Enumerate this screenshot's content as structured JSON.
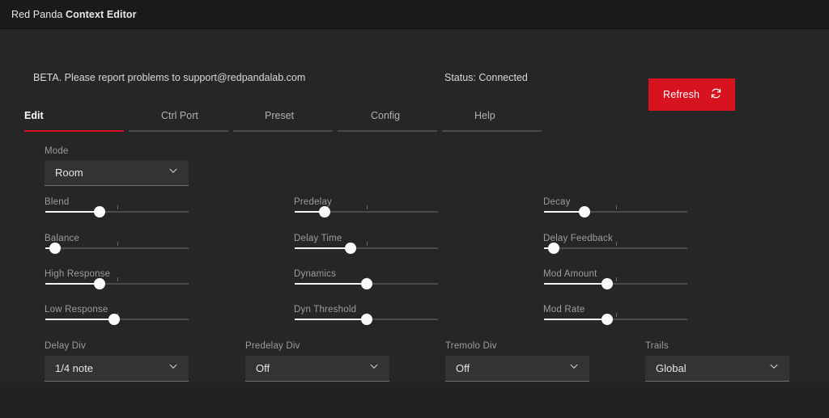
{
  "titlebar": {
    "app_prefix": "Red Panda ",
    "app_title": "Context Editor"
  },
  "header": {
    "beta_notice": "BETA. Please report problems to support@redpandalab.com",
    "status": "Status: Connected",
    "refresh_label": "Refresh",
    "refresh_icon": "refresh-icon",
    "accent_color": "#d7131f"
  },
  "tabs": [
    {
      "label": "Edit",
      "active": true
    },
    {
      "label": "Ctrl Port",
      "active": false
    },
    {
      "label": "Preset",
      "active": false
    },
    {
      "label": "Config",
      "active": false
    },
    {
      "label": "Help",
      "active": false
    }
  ],
  "mode": {
    "label": "Mode",
    "value": "Room"
  },
  "sliders": {
    "column1": [
      {
        "label": "Blend",
        "value": 38
      },
      {
        "label": "Balance",
        "value": 7
      },
      {
        "label": "High Response",
        "value": 38
      },
      {
        "label": "Low Response",
        "value": 48
      }
    ],
    "column2": [
      {
        "label": "Predelay",
        "value": 21
      },
      {
        "label": "Delay Time",
        "value": 39
      },
      {
        "label": "Dynamics",
        "value": 50
      },
      {
        "label": "Dyn Threshold",
        "value": 50
      }
    ],
    "column3": [
      {
        "label": "Decay",
        "value": 28
      },
      {
        "label": "Delay Feedback",
        "value": 7
      },
      {
        "label": "Mod Amount",
        "value": 44
      },
      {
        "label": "Mod Rate",
        "value": 44
      }
    ]
  },
  "divisions": [
    {
      "label": "Delay Div",
      "value": "1/4 note"
    },
    {
      "label": "Predelay Div",
      "value": "Off"
    },
    {
      "label": "Tremolo Div",
      "value": "Off"
    },
    {
      "label": "Trails",
      "value": "Global"
    }
  ]
}
